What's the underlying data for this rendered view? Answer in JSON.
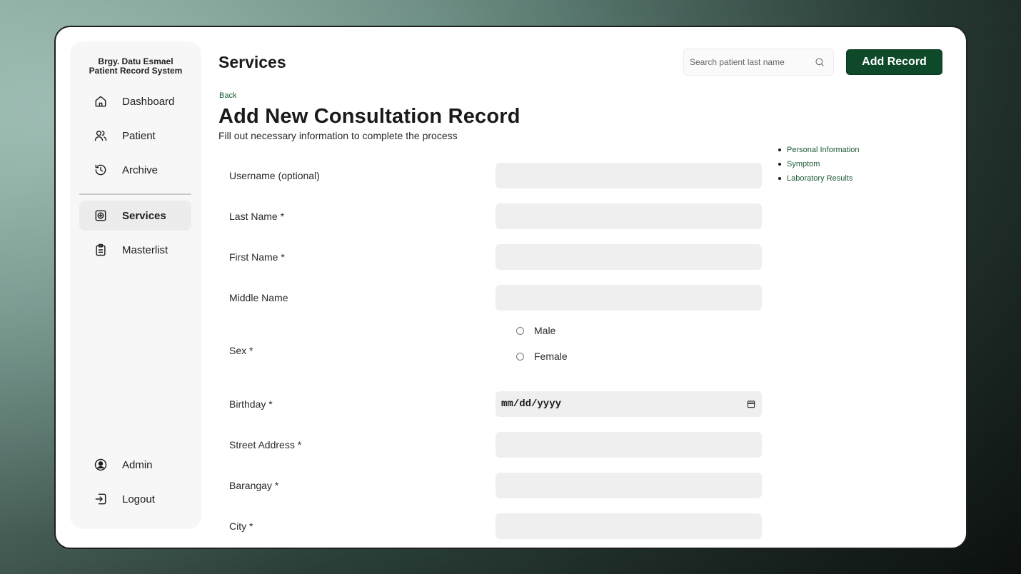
{
  "sidebar": {
    "brand_line1": "Brgy. Datu Esmael",
    "brand_line2": "Patient Record System",
    "items": [
      {
        "label": "Dashboard",
        "icon": "home-icon"
      },
      {
        "label": "Patient",
        "icon": "users-icon"
      },
      {
        "label": "Archive",
        "icon": "history-icon"
      },
      {
        "label": "Services",
        "icon": "medical-box-icon",
        "active": true
      },
      {
        "label": "Masterlist",
        "icon": "clipboard-icon"
      }
    ],
    "bottom_items": [
      {
        "label": "Admin",
        "icon": "user-circle-icon"
      },
      {
        "label": "Logout",
        "icon": "logout-icon"
      }
    ]
  },
  "header": {
    "title": "Services",
    "search_placeholder": "Search patient last name",
    "add_button": "Add Record"
  },
  "form": {
    "back_label": "Back",
    "title": "Add New Consultation Record",
    "subtitle": "Fill out necessary information to complete the process",
    "fields": {
      "username": "Username (optional)",
      "last_name": "Last Name *",
      "first_name": "First Name *",
      "middle_name": "Middle Name",
      "sex": "Sex *",
      "birthday": "Birthday *",
      "street": "Street Address *",
      "barangay": "Barangay *",
      "city": "City *"
    },
    "sex_options": [
      "Male",
      "Female"
    ],
    "birthday_value": "mm/dd/yyyy"
  },
  "toc": [
    "Personal Information",
    "Symptom",
    "Laboratory Results"
  ],
  "colors": {
    "accent": "#0e4a2a",
    "link": "#1d5a35",
    "input_bg": "#efefef"
  }
}
